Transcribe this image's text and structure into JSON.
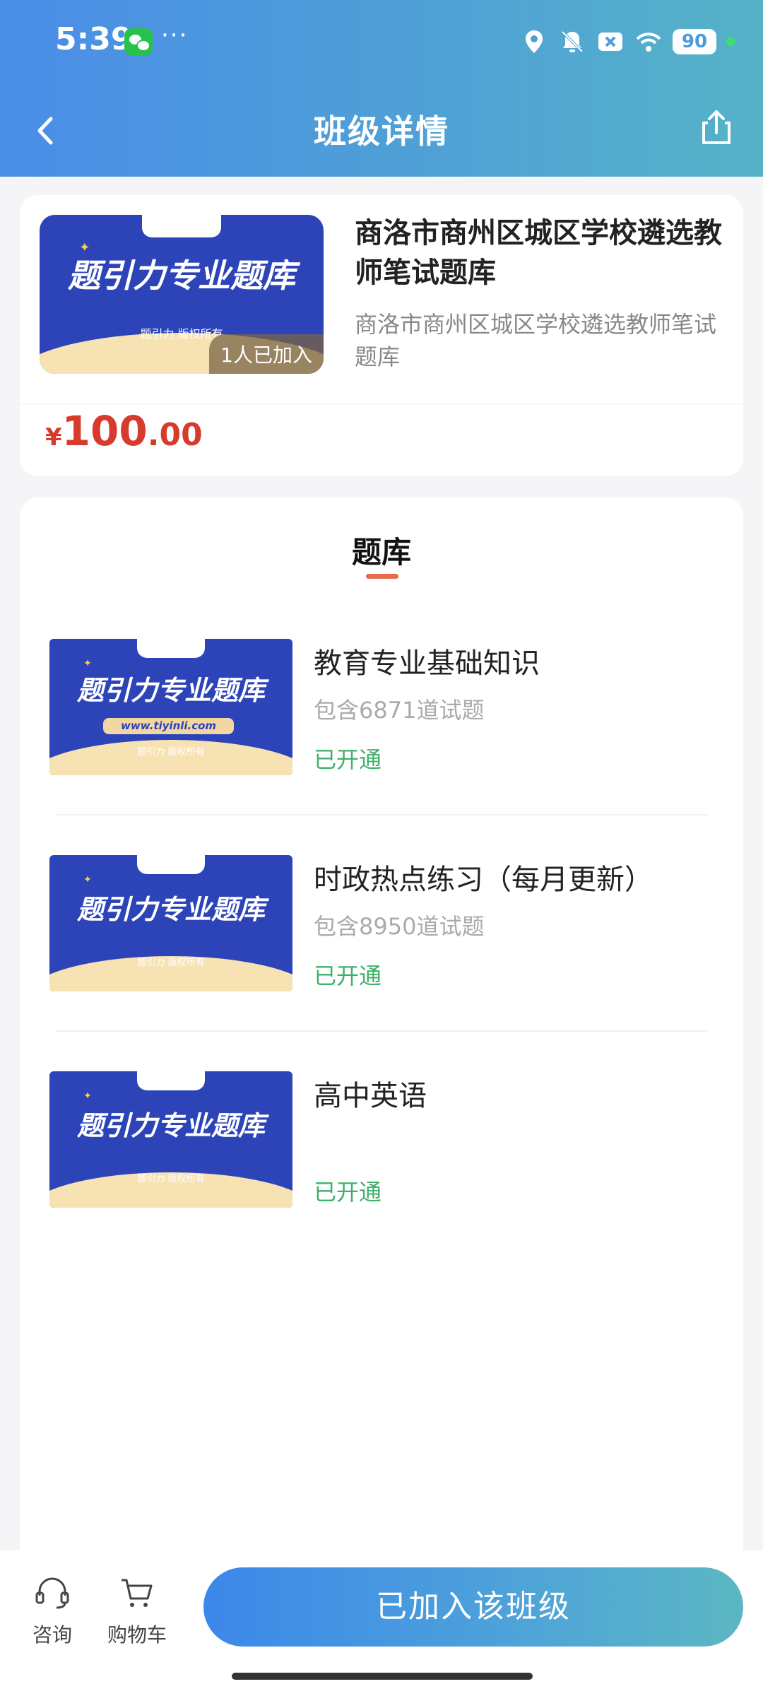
{
  "status_bar": {
    "time": "5:39",
    "more": "···",
    "battery": "90"
  },
  "header": {
    "title": "班级详情"
  },
  "product": {
    "title": "商洛市商州区城区学校遴选教师笔试题库",
    "subtitle": "商洛市商州区城区学校遴选教师笔试题库",
    "join_count": "1人已加入",
    "price_currency": "¥",
    "price_int": "100",
    "price_dec": ".00",
    "thumb": {
      "brand": "题引力专业题库",
      "logo_text": "题引力",
      "copyright": "题引力 版权所有"
    }
  },
  "section": {
    "title": "题库"
  },
  "items": [
    {
      "title": "教育专业基础知识",
      "count": "包含6871道试题",
      "status": "已开通",
      "thumb": {
        "brand": "题引力专业题库",
        "url": "www.tiyinli.com",
        "copyright": "题引力 版权所有"
      }
    },
    {
      "title": "时政热点练习（每月更新）",
      "count": "包含8950道试题",
      "status": "已开通",
      "thumb": {
        "brand": "题引力专业题库",
        "copyright": "题引力 版权所有"
      }
    },
    {
      "title": "高中英语",
      "count": "",
      "status": "已开通",
      "thumb": {
        "brand": "题引力专业题库",
        "copyright": "题引力 版权所有"
      }
    }
  ],
  "bottom_bar": {
    "consult_label": "咨询",
    "cart_label": "购物车",
    "join_label": "已加入该班级"
  },
  "colors": {
    "header_start": "#4a8de8",
    "header_end": "#55b3c8",
    "price": "#d63b2c",
    "status_green": "#3fb06a",
    "underline": "#e86a4a"
  },
  "icons": [
    "wechat-icon",
    "location-icon",
    "bell-off-icon",
    "close-box-icon",
    "wifi-icon",
    "back-icon",
    "share-icon",
    "headset-icon",
    "cart-icon"
  ]
}
